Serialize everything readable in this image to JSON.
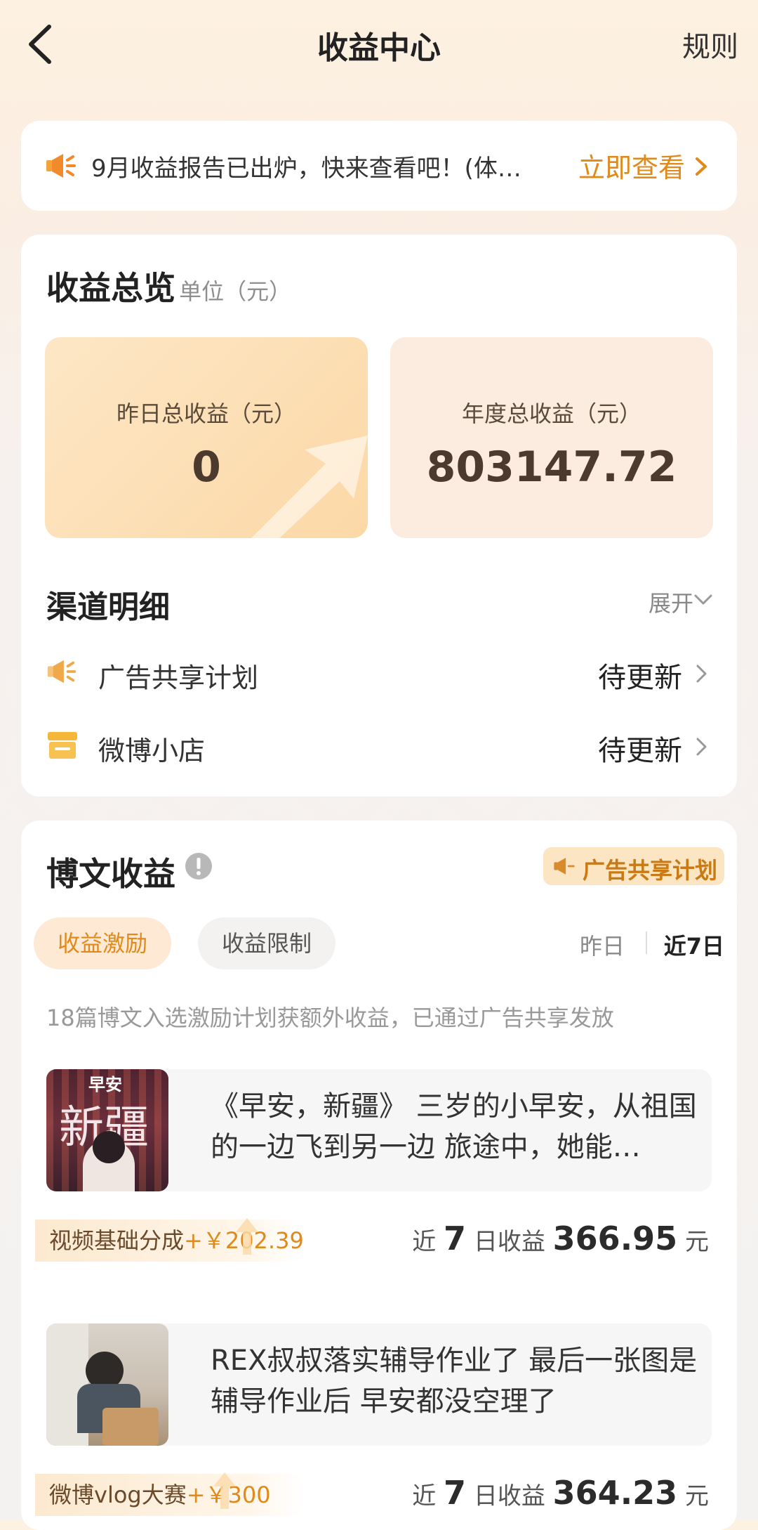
{
  "header": {
    "title": "收益中心",
    "rules": "规则"
  },
  "notice": {
    "text": "9月收益报告已出炉，快来查看吧！(体…",
    "action": "立即查看"
  },
  "overview": {
    "title": "收益总览",
    "unit": "单位（元）",
    "yesterday_label": "昨日总收益（元）",
    "yesterday_value": "0",
    "annual_label": "年度总收益（元）",
    "annual_value": "803147.72"
  },
  "channels": {
    "title": "渠道明细",
    "expand": "展开",
    "items": [
      {
        "label": "广告共享计划",
        "status": "待更新",
        "icon": "megaphone-icon"
      },
      {
        "label": "微博小店",
        "status": "待更新",
        "icon": "shop-icon"
      }
    ]
  },
  "posts_section": {
    "title": "博文收益",
    "badge": "广告共享计划",
    "tabs": [
      "收益激励",
      "收益限制"
    ],
    "range": {
      "yesterday": "昨日",
      "last7": "近7日"
    },
    "note": "18篇博文入选激励计划获额外收益，已通过广告共享发放",
    "posts": [
      {
        "text": "《早安，新疆》 三岁的小早安，从祖国的一边飞到另一边 旅途中，她能…",
        "thumb_text": "新疆",
        "thumb_small": "早安",
        "tag": "视频基础分成",
        "tag_amount": "+￥202.39",
        "earn_prefix": "近",
        "earn_days": "7",
        "earn_mid": "日收益",
        "earn_value": "366.95",
        "earn_unit": "元"
      },
      {
        "text": "REX叔叔落实辅导作业了 最后一张图是辅导作业后 早安都没空理了",
        "tag": "微博vlog大赛",
        "tag_amount": "+￥300",
        "earn_prefix": "近",
        "earn_days": "7",
        "earn_mid": "日收益",
        "earn_value": "364.23",
        "earn_unit": "元"
      }
    ]
  },
  "colors": {
    "accent": "#e08a1c",
    "card_warm": "#fde1bb",
    "card_soft": "#fcece0"
  }
}
